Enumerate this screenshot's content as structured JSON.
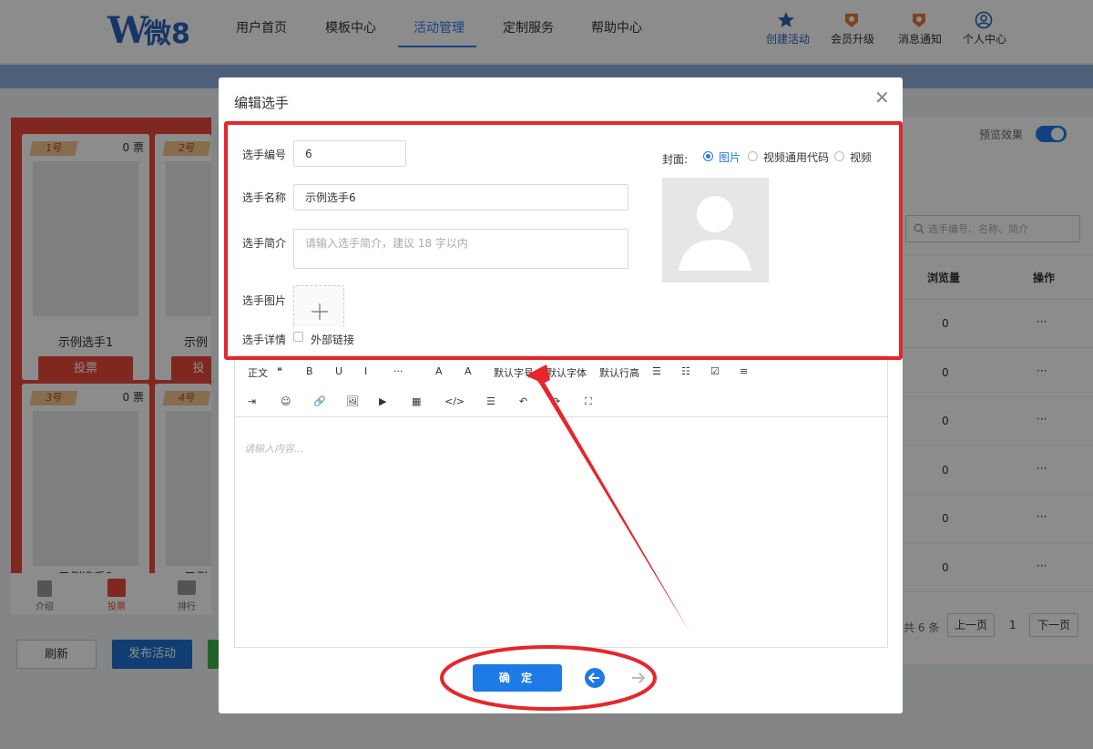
{
  "brand": {
    "logo_w": "W",
    "logo_cn": "微8"
  },
  "nav": {
    "items": [
      "用户首页",
      "模板中心",
      "活动管理",
      "定制服务",
      "帮助中心"
    ],
    "active_index": 2
  },
  "top_actions": {
    "create": "创建活动",
    "vip": "会员升级",
    "messages": "消息通知",
    "profile": "个人中心"
  },
  "phone_preview": {
    "cards": [
      {
        "num": "1号",
        "votes": "0 票",
        "name": "示例选手1",
        "vote": "投票"
      },
      {
        "num": "2号",
        "votes": "",
        "name": "示例",
        "vote": "投"
      },
      {
        "num": "3号",
        "votes": "0 票",
        "name": "示例选手3"
      },
      {
        "num": "4号",
        "votes": "",
        "name": "示例"
      }
    ],
    "tabs": [
      "介绍",
      "投票",
      "排行"
    ]
  },
  "left_buttons": {
    "refresh": "刷新",
    "publish": "发布活动"
  },
  "right_panel": {
    "preview_label": "预览效果",
    "preview_on": true,
    "search_placeholder": "选手编号、名称、简介",
    "columns": [
      "浏览量",
      "操作"
    ],
    "rows": [
      {
        "views": "0",
        "ops": "···"
      },
      {
        "views": "0",
        "ops": "···"
      },
      {
        "views": "0",
        "ops": "···"
      },
      {
        "views": "0",
        "ops": "···"
      },
      {
        "views": "0",
        "ops": "···"
      },
      {
        "views": "0",
        "ops": "···"
      }
    ],
    "pagination": {
      "total": "共 6 条",
      "prev": "上一页",
      "page": "1",
      "next": "下一页"
    }
  },
  "modal": {
    "title": "编辑选手",
    "fields": {
      "number_label": "选手编号",
      "number_value": "6",
      "name_label": "选手名称",
      "name_value": "示例选手6",
      "intro_label": "选手简介",
      "intro_placeholder": "请输入选手简介，建议 18 字以内",
      "image_label": "选手图片",
      "detail_label": "选手详情",
      "external_link": "外部链接"
    },
    "cover": {
      "label": "封面:",
      "options": [
        "图片",
        "视频通用代码",
        "视频"
      ],
      "selected_index": 0
    },
    "toolbar": {
      "row1": [
        "正文",
        "❝",
        "B",
        "U",
        "I",
        "···",
        "A",
        "A",
        "默认字号",
        "默认字体",
        "默认行高",
        "☰",
        "☷",
        "☑",
        "≡"
      ],
      "row2": [
        "⇥",
        "☺",
        "🔗",
        "🖼",
        "▶",
        "▦",
        "</>",
        "☰",
        "↶",
        "↷",
        "⛶"
      ]
    },
    "editor_placeholder": "请输入内容...",
    "confirm_button": "确 定"
  },
  "colors": {
    "accent": "#1e7be6",
    "annotation": "#e5262b",
    "phone_bg": "#e9473a",
    "publish": "#1e6fd0"
  }
}
